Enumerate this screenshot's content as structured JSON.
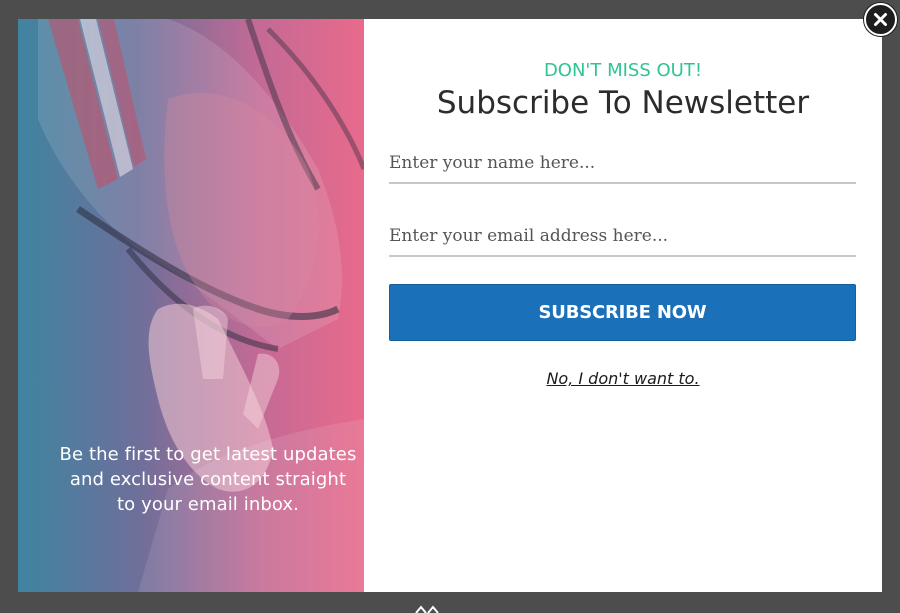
{
  "popup": {
    "kicker": "DON'T MISS OUT!",
    "title": "Subscribe To Newsletter",
    "name_placeholder": "Enter your name here...",
    "email_placeholder": "Enter your email address here...",
    "subscribe_label": "SUBSCRIBE NOW",
    "decline_label": "No, I don't want to.",
    "tagline": "Be the first to get latest updates and exclusive content straight to your email inbox.",
    "close_icon": "close-icon",
    "hero_image": "football-player-helmet-photo"
  },
  "colors": {
    "overlay": "#4d4d4d",
    "kicker": "#2ec58f",
    "button": "#1a70b9",
    "gradient_left": "#3f84a0",
    "gradient_right": "#e86a8c"
  }
}
